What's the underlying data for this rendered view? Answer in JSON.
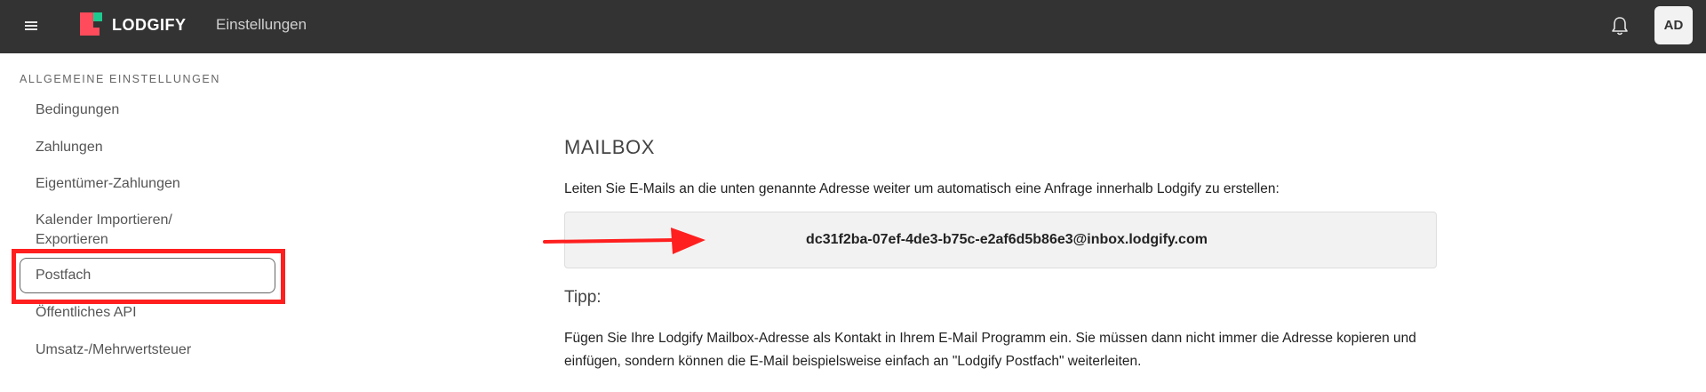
{
  "header": {
    "brand": "LODGIFY",
    "page_title": "Einstellungen",
    "avatar_initials": "AD",
    "icons": {
      "menu": "hamburger-menu-icon",
      "notifications": "bell-icon"
    },
    "colors": {
      "bar": "#333333",
      "logo_red": "#ff4b5c",
      "logo_green": "#1dc98e"
    }
  },
  "sidebar": {
    "section_label": "ALLGEMEINE EINSTELLUNGEN",
    "items": [
      {
        "label": "Bedingungen"
      },
      {
        "label": "Zahlungen"
      },
      {
        "label": "Eigentümer-Zahlungen"
      },
      {
        "label_line1": "Kalender Importieren/",
        "label_line2": "Exportieren"
      },
      {
        "label": "Postfach",
        "selected": true
      },
      {
        "label": "Öffentliches API"
      },
      {
        "label": "Umsatz-/Mehrwertsteuer"
      }
    ]
  },
  "main": {
    "title": "MAILBOX",
    "description": "Leiten Sie E-Mails an die unten genannte Adresse weiter um automatisch eine Anfrage innerhalb Lodgify zu erstellen:",
    "address": "dc31f2ba-07ef-4de3-b75c-e2af6d5b86e3@inbox.lodgify.com",
    "tip_label": "Tipp:",
    "tip_text": "Fügen Sie Ihre Lodgify Mailbox-Adresse als Kontakt in Ihrem E-Mail Programm ein. Sie müssen dann nicht immer die Adresse kopieren und einfügen, sondern können die E-Mail beispielsweise einfach an \"Lodgify Postfach\" weiterleiten."
  },
  "annotations": {
    "highlight_color": "#ff1f1f",
    "arrow_icon": "red-arrow-right-icon"
  }
}
